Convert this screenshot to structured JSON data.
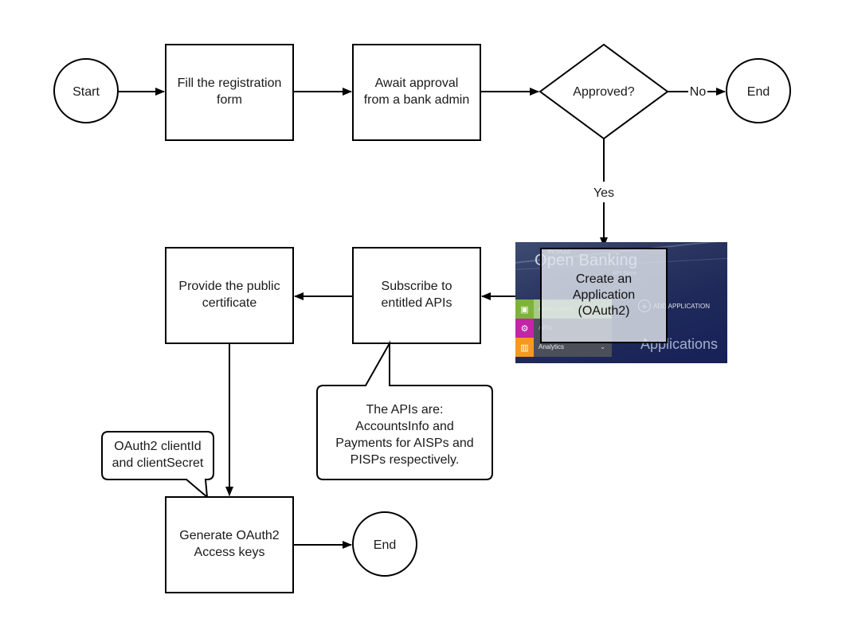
{
  "diagram": {
    "nodes": {
      "start": "Start",
      "fill_form": [
        "Fill the registration",
        "form"
      ],
      "await_approval": [
        "Await approval",
        "from a bank admin"
      ],
      "approved": "Approved?",
      "end_rejected": "End",
      "create_app": "Create an\nApplication\n(OAuth2)",
      "subscribe": [
        "Subscribe to",
        "entitled APIs"
      ],
      "provide_cert": [
        "Provide the public",
        "certificate"
      ],
      "generate_keys": [
        "Generate OAuth2",
        "Access keys"
      ],
      "end_final": "End"
    },
    "edge_labels": {
      "no": "No",
      "yes": "Yes"
    },
    "callouts": {
      "apis": [
        "The APIs are:",
        "AccountsInfo and",
        "Payments for AISPs and",
        "PISPs respectively."
      ],
      "oauth": [
        "OAuth2 clientId",
        "and clientSecret"
      ]
    }
  },
  "embedded_screenshot": {
    "logo": "WSO2",
    "brand": "Open Banking",
    "subtitle": "API Store",
    "menu": [
      {
        "label": "Applications",
        "icon": "application-window-icon",
        "color": "#7db33a"
      },
      {
        "label": "APIs",
        "icon": "api-gear-icon",
        "color": "#c225a7"
      },
      {
        "label": "Analytics",
        "icon": "bar-chart-icon",
        "color": "#f39a22"
      }
    ],
    "add_button": "ADD APPLICATION",
    "page_title": "Applications"
  }
}
